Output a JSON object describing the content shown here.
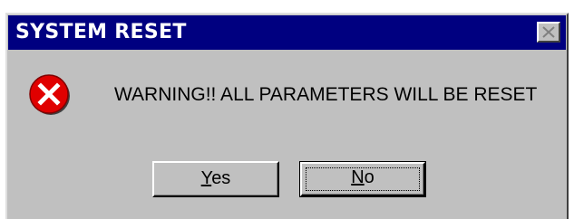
{
  "window": {
    "title": "SYSTEM RESET"
  },
  "dialog": {
    "icon": "error-icon",
    "message": "WARNING!! ALL PARAMETERS WILL BE RESET"
  },
  "buttons": {
    "yes_mnemonic": "Y",
    "yes_rest": "es",
    "no_mnemonic": "N",
    "no_rest": "o"
  },
  "colors": {
    "titlebar": "#000080",
    "face": "#c0c0c0",
    "error": "#e00000"
  }
}
